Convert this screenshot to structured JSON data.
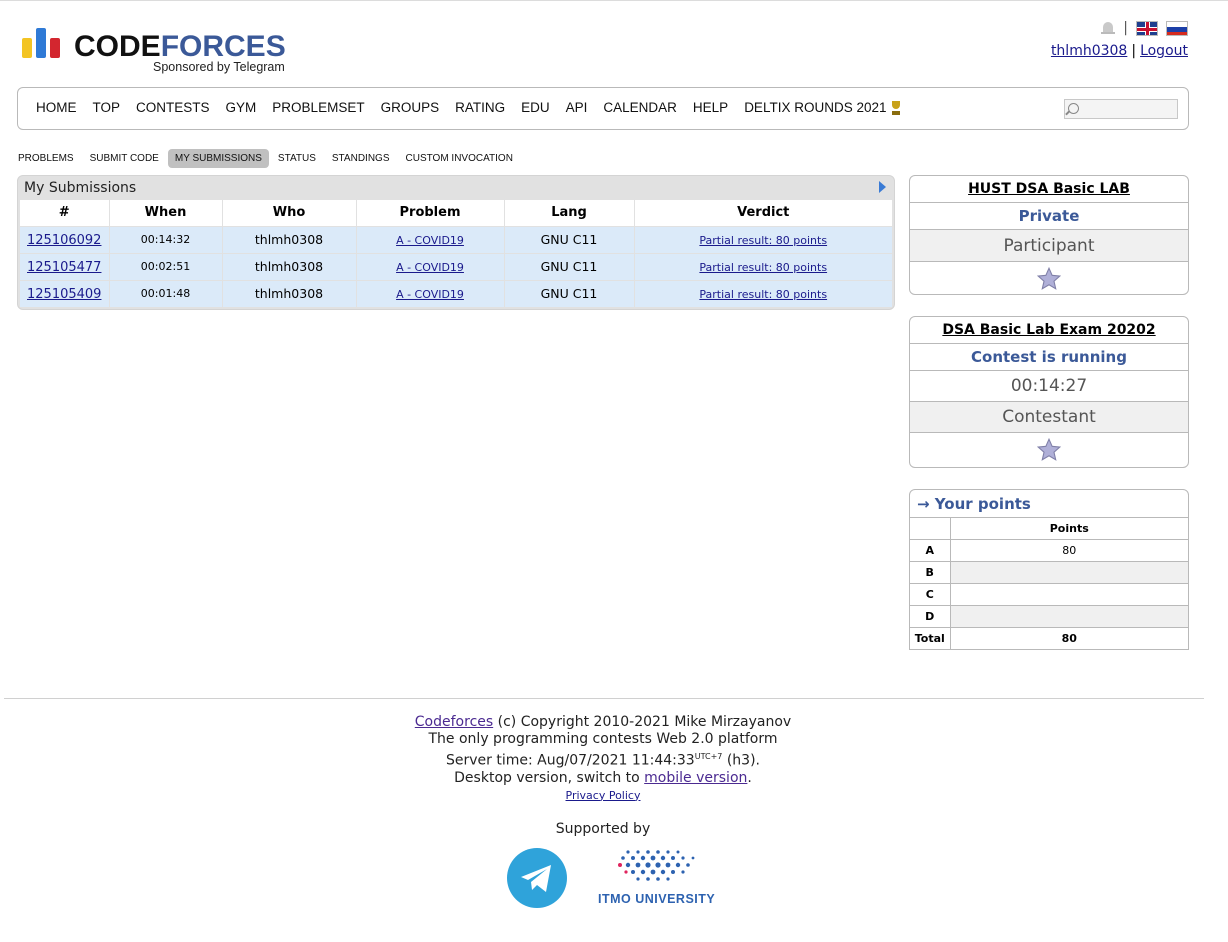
{
  "header": {
    "logo_word_1": "CODE",
    "logo_word_2": "FORCES",
    "sponsor": "Sponsored by Telegram",
    "username": "thlmh0308",
    "logout": "Logout",
    "separator": "|"
  },
  "menu": [
    "HOME",
    "TOP",
    "CONTESTS",
    "GYM",
    "PROBLEMSET",
    "GROUPS",
    "RATING",
    "EDU",
    "API",
    "CALENDAR",
    "HELP",
    "DELTIX ROUNDS 2021"
  ],
  "subtabs": [
    "PROBLEMS",
    "SUBMIT CODE",
    "MY SUBMISSIONS",
    "STATUS",
    "STANDINGS",
    "CUSTOM INVOCATION"
  ],
  "submissions": {
    "caption": "My Submissions",
    "headers": [
      "#",
      "When",
      "Who",
      "Problem",
      "Lang",
      "Verdict"
    ],
    "rows": [
      {
        "id": "125106092",
        "when": "00:14:32",
        "who": "thlmh0308",
        "problem": "A - COVID19",
        "lang": "GNU C11",
        "verdict": "Partial result: 80 points"
      },
      {
        "id": "125105477",
        "when": "00:02:51",
        "who": "thlmh0308",
        "problem": "A - COVID19",
        "lang": "GNU C11",
        "verdict": "Partial result: 80 points"
      },
      {
        "id": "125105409",
        "when": "00:01:48",
        "who": "thlmh0308",
        "problem": "A - COVID19",
        "lang": "GNU C11",
        "verdict": "Partial result: 80 points"
      }
    ]
  },
  "group_box": {
    "title": "HUST DSA Basic LAB",
    "visibility": "Private",
    "role": "Participant"
  },
  "contest_box": {
    "title": "DSA Basic Lab Exam 20202",
    "state": "Contest is running",
    "timer": "00:14:27",
    "role": "Contestant"
  },
  "points_box": {
    "title": "→ Your points",
    "column": "Points",
    "rows": [
      {
        "label": "A",
        "value": "80"
      },
      {
        "label": "B",
        "value": ""
      },
      {
        "label": "C",
        "value": ""
      },
      {
        "label": "D",
        "value": ""
      }
    ],
    "total_label": "Total",
    "total_value": "80"
  },
  "footer": {
    "link": "Codeforces",
    "copyright": "(c) Copyright 2010-2021 Mike Mirzayanov",
    "line2": "The only programming contests Web 2.0 platform",
    "server_time_prefix": "Server time: Aug/07/2021 11:44:33",
    "tz": "UTC+7",
    "server_suffix": "(h3).",
    "desktop_prefix": "Desktop version, switch to",
    "mobile_link": "mobile version",
    "privacy": "Privacy Policy",
    "supported_by": "Supported by",
    "itmo": "ITMO UNIVERSITY"
  },
  "colors": {
    "brand_blue": "#3b5998",
    "row_blue": "#dbeaf9",
    "link": "#1a1a8c"
  }
}
